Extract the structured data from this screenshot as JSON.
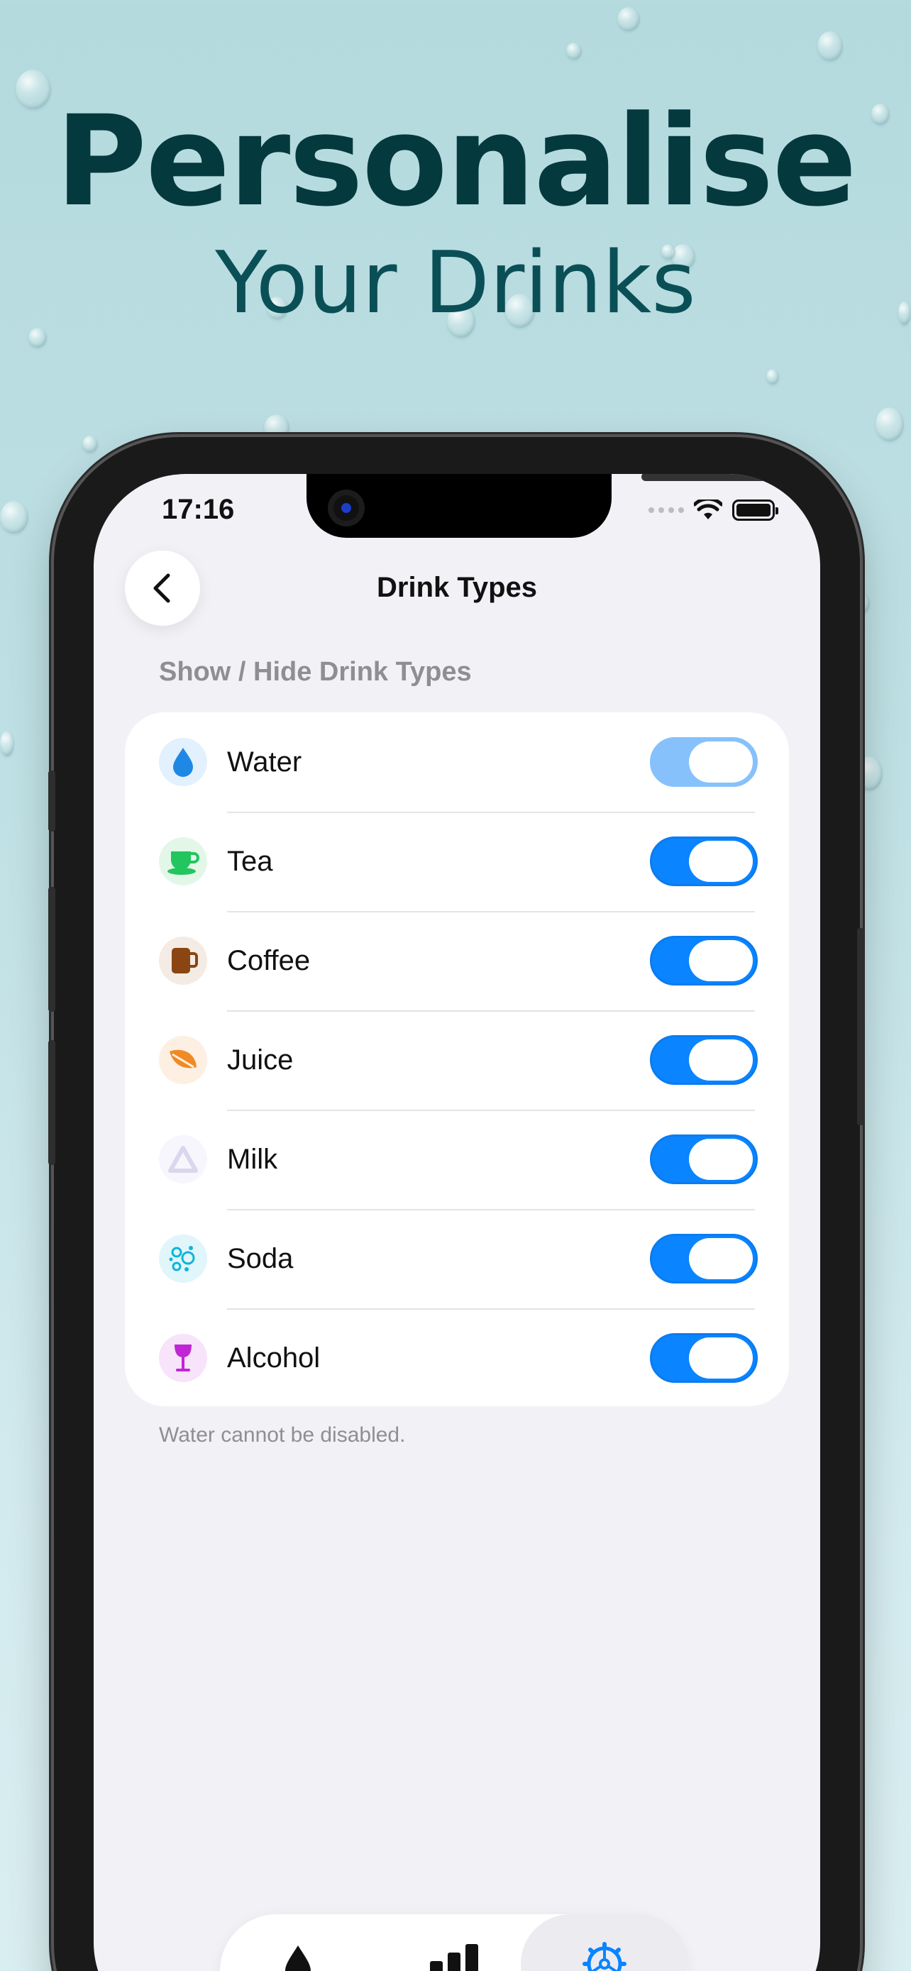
{
  "headline": "Personalise",
  "subheadline": "Your Drinks",
  "status_bar": {
    "time": "17:16"
  },
  "nav": {
    "title": "Drink Types"
  },
  "section": {
    "title": "Show / Hide Drink Types"
  },
  "drink_types": [
    {
      "label": "Water",
      "icon": "water-drop-icon",
      "color": "#1e88e5",
      "bg": "#e3f0fd",
      "enabled": true,
      "locked": true
    },
    {
      "label": "Tea",
      "icon": "teacup-icon",
      "color": "#22c55e",
      "bg": "#e3f7e9",
      "enabled": true,
      "locked": false
    },
    {
      "label": "Coffee",
      "icon": "mug-icon",
      "color": "#8b4513",
      "bg": "#f4ebe4",
      "enabled": true,
      "locked": false
    },
    {
      "label": "Juice",
      "icon": "leaf-icon",
      "color": "#f08a24",
      "bg": "#fdefe2",
      "enabled": true,
      "locked": false
    },
    {
      "label": "Milk",
      "icon": "milk-icon",
      "color": "#d9d6ee",
      "bg": "#f7f6fc",
      "enabled": true,
      "locked": false
    },
    {
      "label": "Soda",
      "icon": "bubbles-icon",
      "color": "#0fb5d6",
      "bg": "#e0f6fb",
      "enabled": true,
      "locked": false
    },
    {
      "label": "Alcohol",
      "icon": "wine-glass-icon",
      "color": "#c026d3",
      "bg": "#f7e3fa",
      "enabled": true,
      "locked": false
    }
  ],
  "footnote": "Water cannot be disabled.",
  "tabs": [
    {
      "icon": "water-drop-icon",
      "active": false
    },
    {
      "icon": "bar-chart-icon",
      "active": false
    },
    {
      "icon": "gear-icon",
      "active": true
    }
  ],
  "colors": {
    "accent": "#0a84ff",
    "headline": "#04393e",
    "background": "#b4dade"
  }
}
